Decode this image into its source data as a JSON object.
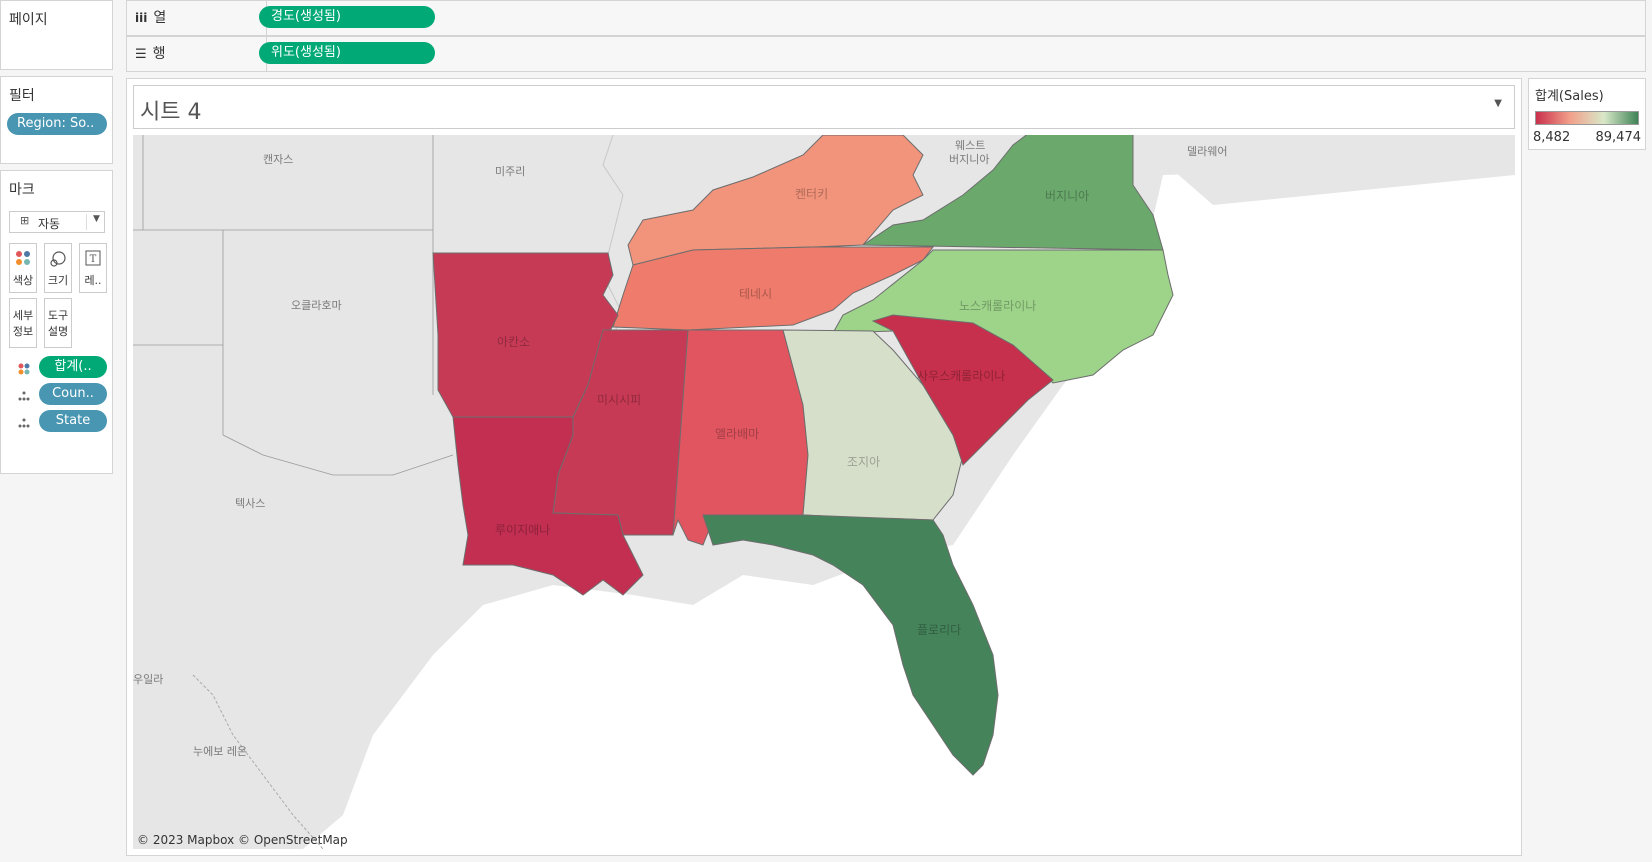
{
  "pages_label": "페이지",
  "shelves": {
    "columns": {
      "label": "열",
      "pill": "경도(생성됨)"
    },
    "rows": {
      "label": "행",
      "pill": "위도(생성됨)"
    }
  },
  "filters": {
    "title": "필터",
    "pill": "Region: So.."
  },
  "marks": {
    "title": "마크",
    "type": "자동",
    "buttons": [
      {
        "label": "색상",
        "icon": "color-dots-icon"
      },
      {
        "label": "크기",
        "icon": "size-icon"
      },
      {
        "label": "레..",
        "icon": "text-icon"
      },
      {
        "label1": "세부",
        "label2": "정보",
        "icon": "detail-icon"
      },
      {
        "label1": "도구",
        "label2": "설명",
        "icon": "tooltip-icon"
      }
    ],
    "fields": [
      "합계(..",
      "Coun..",
      "State"
    ]
  },
  "sheet": {
    "title": "시트 4"
  },
  "legend": {
    "title": "합계(Sales)",
    "min": "8,482",
    "max": "89,474",
    "colors": {
      "low": "#c9304c",
      "mid": "#f2a08b",
      "high": "#3f8356"
    }
  },
  "map": {
    "attribution": "© 2023 Mapbox © OpenStreetMap",
    "background_labels": {
      "kansas": "캔자스",
      "missouri": "미주리",
      "westvirginia1": "웨스트",
      "westvirginia2": "버지니아",
      "delaware": "델라웨어",
      "oklahoma": "오클라호마",
      "texas": "텍사스",
      "coahuila": "우일라",
      "nuevoleon": "누에보 레온"
    },
    "state_labels": {
      "kentucky": "켄터키",
      "virginia": "버지니아",
      "tennessee": "테네시",
      "northcarolina": "노스캐롤라이나",
      "arkansas": "아칸소",
      "southcarolina": "사우스캐롤라이나",
      "mississippi": "미시시피",
      "alabama": "앨라배마",
      "georgia": "조지아",
      "louisiana": "루이지애나",
      "florida": "플로리다"
    },
    "state_colors": {
      "kentucky": "#f2937b",
      "virginia": "#6aa86c",
      "tennessee": "#ee7b6b",
      "northcarolina": "#9dd48a",
      "arkansas": "#c73a55",
      "southcarolina": "#c6304c",
      "mississippi": "#c73a55",
      "alabama": "#e05560",
      "georgia": "#d6dfca",
      "louisiana": "#c22f50",
      "florida": "#45835a"
    }
  }
}
